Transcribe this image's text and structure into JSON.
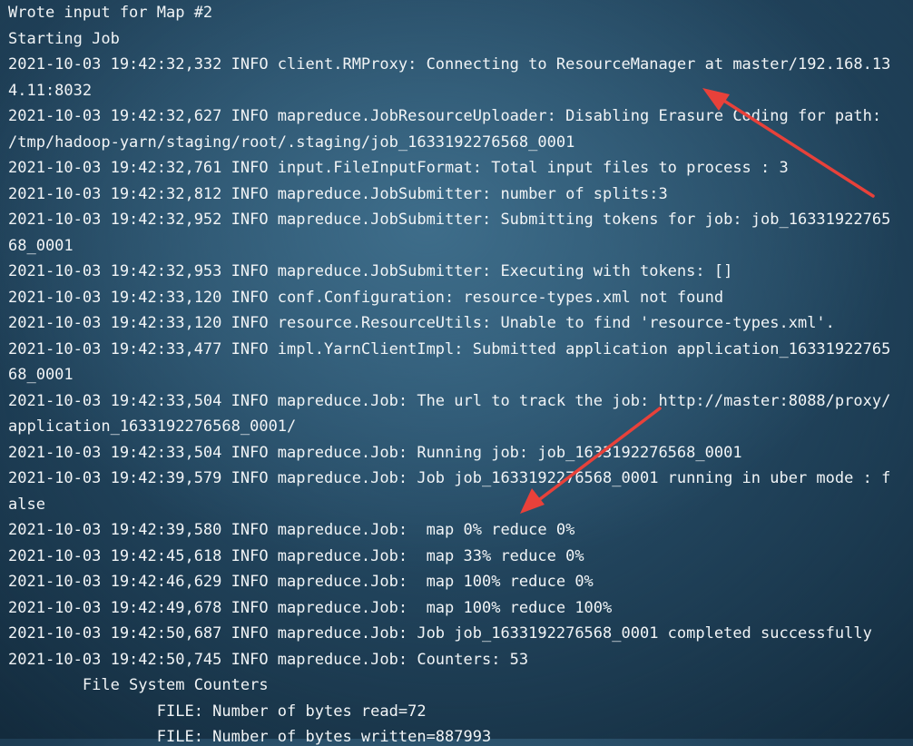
{
  "terminal": {
    "lines": [
      "Wrote input for Map #2",
      "Starting Job",
      "2021-10-03 19:42:32,332 INFO client.RMProxy: Connecting to ResourceManager at master/192.168.13",
      "4.11:8032",
      "2021-10-03 19:42:32,627 INFO mapreduce.JobResourceUploader: Disabling Erasure Coding for path:",
      "/tmp/hadoop-yarn/staging/root/.staging/job_1633192276568_0001",
      "2021-10-03 19:42:32,761 INFO input.FileInputFormat: Total input files to process : 3",
      "2021-10-03 19:42:32,812 INFO mapreduce.JobSubmitter: number of splits:3",
      "2021-10-03 19:42:32,952 INFO mapreduce.JobSubmitter: Submitting tokens for job: job_16331922765",
      "68_0001",
      "2021-10-03 19:42:32,953 INFO mapreduce.JobSubmitter: Executing with tokens: []",
      "2021-10-03 19:42:33,120 INFO conf.Configuration: resource-types.xml not found",
      "2021-10-03 19:42:33,120 INFO resource.ResourceUtils: Unable to find 'resource-types.xml'.",
      "2021-10-03 19:42:33,477 INFO impl.YarnClientImpl: Submitted application application_16331922765",
      "68_0001",
      "2021-10-03 19:42:33,504 INFO mapreduce.Job: The url to track the job: http://master:8088/proxy/",
      "application_1633192276568_0001/",
      "2021-10-03 19:42:33,504 INFO mapreduce.Job: Running job: job_1633192276568_0001",
      "2021-10-03 19:42:39,579 INFO mapreduce.Job: Job job_1633192276568_0001 running in uber mode : f",
      "alse",
      "2021-10-03 19:42:39,580 INFO mapreduce.Job:  map 0% reduce 0%",
      "2021-10-03 19:42:45,618 INFO mapreduce.Job:  map 33% reduce 0%",
      "2021-10-03 19:42:46,629 INFO mapreduce.Job:  map 100% reduce 0%",
      "2021-10-03 19:42:49,678 INFO mapreduce.Job:  map 100% reduce 100%",
      "2021-10-03 19:42:50,687 INFO mapreduce.Job: Job job_1633192276568_0001 completed successfully",
      "2021-10-03 19:42:50,745 INFO mapreduce.Job: Counters: 53",
      "        File System Counters",
      "                FILE: Number of bytes read=72",
      "                FILE: Number of bytes written=887993"
    ]
  },
  "annotations": {
    "arrow_color": "#e8413a",
    "arrow_names": [
      "annotation-arrow",
      "annotation-arrow"
    ]
  },
  "colors": {
    "text": "#f1f4f6",
    "background": "#1f4258"
  }
}
